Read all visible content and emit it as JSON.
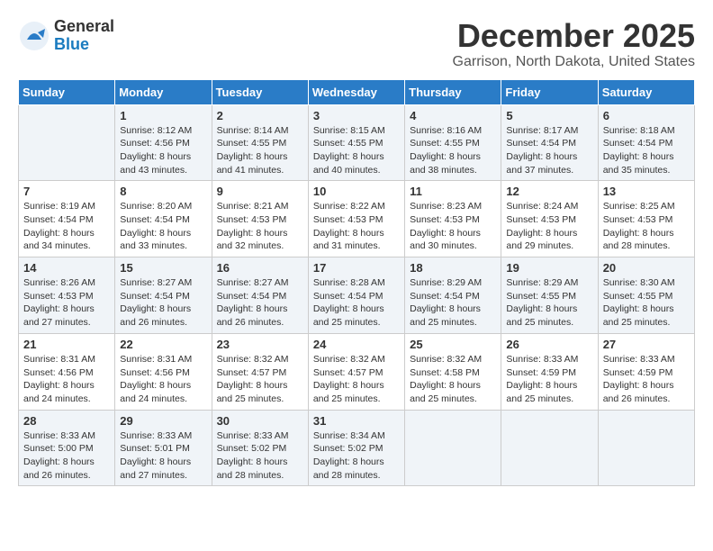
{
  "logo": {
    "general": "General",
    "blue": "Blue"
  },
  "title": "December 2025",
  "location": "Garrison, North Dakota, United States",
  "days_of_week": [
    "Sunday",
    "Monday",
    "Tuesday",
    "Wednesday",
    "Thursday",
    "Friday",
    "Saturday"
  ],
  "weeks": [
    [
      {
        "day": "",
        "info": ""
      },
      {
        "day": "1",
        "info": "Sunrise: 8:12 AM\nSunset: 4:56 PM\nDaylight: 8 hours\nand 43 minutes."
      },
      {
        "day": "2",
        "info": "Sunrise: 8:14 AM\nSunset: 4:55 PM\nDaylight: 8 hours\nand 41 minutes."
      },
      {
        "day": "3",
        "info": "Sunrise: 8:15 AM\nSunset: 4:55 PM\nDaylight: 8 hours\nand 40 minutes."
      },
      {
        "day": "4",
        "info": "Sunrise: 8:16 AM\nSunset: 4:55 PM\nDaylight: 8 hours\nand 38 minutes."
      },
      {
        "day": "5",
        "info": "Sunrise: 8:17 AM\nSunset: 4:54 PM\nDaylight: 8 hours\nand 37 minutes."
      },
      {
        "day": "6",
        "info": "Sunrise: 8:18 AM\nSunset: 4:54 PM\nDaylight: 8 hours\nand 35 minutes."
      }
    ],
    [
      {
        "day": "7",
        "info": "Sunrise: 8:19 AM\nSunset: 4:54 PM\nDaylight: 8 hours\nand 34 minutes."
      },
      {
        "day": "8",
        "info": "Sunrise: 8:20 AM\nSunset: 4:54 PM\nDaylight: 8 hours\nand 33 minutes."
      },
      {
        "day": "9",
        "info": "Sunrise: 8:21 AM\nSunset: 4:53 PM\nDaylight: 8 hours\nand 32 minutes."
      },
      {
        "day": "10",
        "info": "Sunrise: 8:22 AM\nSunset: 4:53 PM\nDaylight: 8 hours\nand 31 minutes."
      },
      {
        "day": "11",
        "info": "Sunrise: 8:23 AM\nSunset: 4:53 PM\nDaylight: 8 hours\nand 30 minutes."
      },
      {
        "day": "12",
        "info": "Sunrise: 8:24 AM\nSunset: 4:53 PM\nDaylight: 8 hours\nand 29 minutes."
      },
      {
        "day": "13",
        "info": "Sunrise: 8:25 AM\nSunset: 4:53 PM\nDaylight: 8 hours\nand 28 minutes."
      }
    ],
    [
      {
        "day": "14",
        "info": "Sunrise: 8:26 AM\nSunset: 4:53 PM\nDaylight: 8 hours\nand 27 minutes."
      },
      {
        "day": "15",
        "info": "Sunrise: 8:27 AM\nSunset: 4:54 PM\nDaylight: 8 hours\nand 26 minutes."
      },
      {
        "day": "16",
        "info": "Sunrise: 8:27 AM\nSunset: 4:54 PM\nDaylight: 8 hours\nand 26 minutes."
      },
      {
        "day": "17",
        "info": "Sunrise: 8:28 AM\nSunset: 4:54 PM\nDaylight: 8 hours\nand 25 minutes."
      },
      {
        "day": "18",
        "info": "Sunrise: 8:29 AM\nSunset: 4:54 PM\nDaylight: 8 hours\nand 25 minutes."
      },
      {
        "day": "19",
        "info": "Sunrise: 8:29 AM\nSunset: 4:55 PM\nDaylight: 8 hours\nand 25 minutes."
      },
      {
        "day": "20",
        "info": "Sunrise: 8:30 AM\nSunset: 4:55 PM\nDaylight: 8 hours\nand 25 minutes."
      }
    ],
    [
      {
        "day": "21",
        "info": "Sunrise: 8:31 AM\nSunset: 4:56 PM\nDaylight: 8 hours\nand 24 minutes."
      },
      {
        "day": "22",
        "info": "Sunrise: 8:31 AM\nSunset: 4:56 PM\nDaylight: 8 hours\nand 24 minutes."
      },
      {
        "day": "23",
        "info": "Sunrise: 8:32 AM\nSunset: 4:57 PM\nDaylight: 8 hours\nand 25 minutes."
      },
      {
        "day": "24",
        "info": "Sunrise: 8:32 AM\nSunset: 4:57 PM\nDaylight: 8 hours\nand 25 minutes."
      },
      {
        "day": "25",
        "info": "Sunrise: 8:32 AM\nSunset: 4:58 PM\nDaylight: 8 hours\nand 25 minutes."
      },
      {
        "day": "26",
        "info": "Sunrise: 8:33 AM\nSunset: 4:59 PM\nDaylight: 8 hours\nand 25 minutes."
      },
      {
        "day": "27",
        "info": "Sunrise: 8:33 AM\nSunset: 4:59 PM\nDaylight: 8 hours\nand 26 minutes."
      }
    ],
    [
      {
        "day": "28",
        "info": "Sunrise: 8:33 AM\nSunset: 5:00 PM\nDaylight: 8 hours\nand 26 minutes."
      },
      {
        "day": "29",
        "info": "Sunrise: 8:33 AM\nSunset: 5:01 PM\nDaylight: 8 hours\nand 27 minutes."
      },
      {
        "day": "30",
        "info": "Sunrise: 8:33 AM\nSunset: 5:02 PM\nDaylight: 8 hours\nand 28 minutes."
      },
      {
        "day": "31",
        "info": "Sunrise: 8:34 AM\nSunset: 5:02 PM\nDaylight: 8 hours\nand 28 minutes."
      },
      {
        "day": "",
        "info": ""
      },
      {
        "day": "",
        "info": ""
      },
      {
        "day": "",
        "info": ""
      }
    ]
  ]
}
